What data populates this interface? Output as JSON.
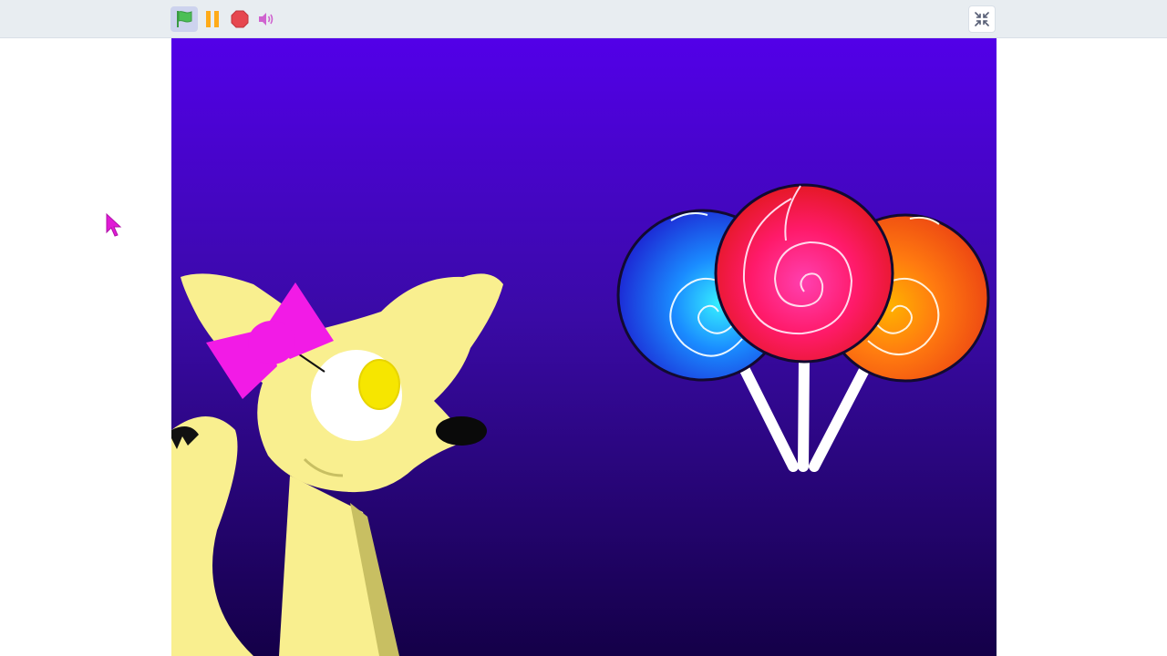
{
  "toolbar": {
    "icons": [
      "green-flag-icon",
      "pause-icon",
      "stop-icon",
      "sound-icon"
    ],
    "exit_fullscreen_icon": "shrink-arrows-icon"
  },
  "stage": {
    "background_gradient": [
      "#5200e8",
      "#140048"
    ],
    "sprites": [
      "fox-character",
      "lollipop-blue",
      "lollipop-red",
      "lollipop-orange"
    ]
  },
  "colors": {
    "flag": "#4cbf56",
    "pause": "#ffab19",
    "stop": "#e6474f",
    "sound": "#cf63cf",
    "fox_body": "#f9ef8f",
    "bow": "#f21be6"
  }
}
